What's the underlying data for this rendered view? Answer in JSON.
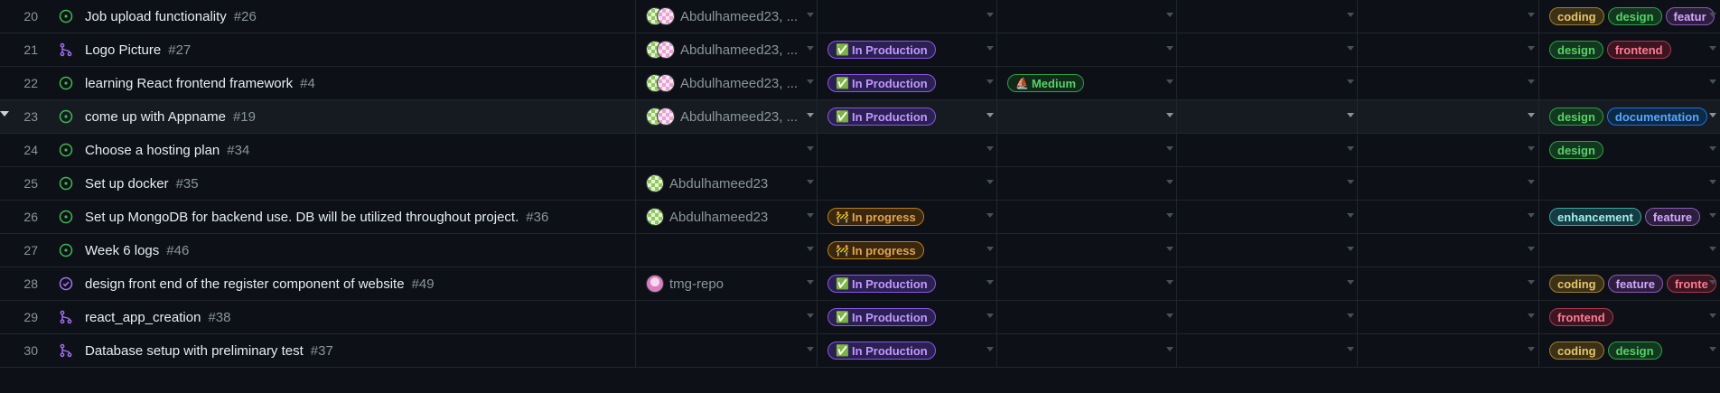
{
  "status_styles": {
    "In Production": {
      "bg": "#2b2052",
      "border": "#8957e5",
      "color": "#c297ff",
      "emoji": "✅"
    },
    "In progress": {
      "bg": "#3a2710",
      "border": "#bb8009",
      "color": "#e3a44d",
      "emoji": "🚧"
    }
  },
  "priority_styles": {
    "Medium": {
      "bg": "#10291a",
      "border": "#2ea043",
      "color": "#56d364",
      "emoji": "⛵"
    }
  },
  "label_styles": {
    "coding": {
      "bg": "#3b3117",
      "border": "#9e7c2f",
      "color": "#e8c56a"
    },
    "design": {
      "bg": "#123820",
      "border": "#2ea043",
      "color": "#56d364"
    },
    "feature": {
      "bg": "#2d1e3d",
      "border": "#8a5ab5",
      "color": "#d2a8ff"
    },
    "frontend": {
      "bg": "#3d1520",
      "border": "#a8394f",
      "color": "#ff7b93"
    },
    "documentation": {
      "bg": "#0d2a45",
      "border": "#1f6feb",
      "color": "#58a6ff"
    },
    "enhancement": {
      "bg": "#153c40",
      "border": "#3aa3a8",
      "color": "#a2eeef"
    }
  },
  "rows": [
    {
      "num": "20",
      "icon": "issue-open",
      "title": "Job upload functionality",
      "ref": "#26",
      "avatars": [
        "green",
        "pink"
      ],
      "assignees": "Abdulhameed23, ...",
      "status": "",
      "priority": "",
      "labels": [
        "coding",
        "design",
        "featur"
      ]
    },
    {
      "num": "21",
      "icon": "pull-request",
      "title": "Logo Picture",
      "ref": "#27",
      "avatars": [
        "green",
        "pink"
      ],
      "assignees": "Abdulhameed23, ...",
      "status": "In Production",
      "priority": "",
      "labels": [
        "design",
        "frontend"
      ]
    },
    {
      "num": "22",
      "icon": "issue-open",
      "title": "learning React frontend framework",
      "ref": "#4",
      "avatars": [
        "green",
        "pink"
      ],
      "assignees": "Abdulhameed23, ...",
      "status": "In Production",
      "priority": "Medium",
      "labels": []
    },
    {
      "num": "23",
      "icon": "issue-open",
      "title": "come up with Appname",
      "ref": "#19",
      "avatars": [
        "green",
        "pink"
      ],
      "assignees": "Abdulhameed23, ...",
      "status": "In Production",
      "priority": "",
      "labels": [
        "design",
        "documentation"
      ],
      "hover": true
    },
    {
      "num": "24",
      "icon": "issue-open",
      "title": "Choose a hosting plan",
      "ref": "#34",
      "avatars": [],
      "assignees": "",
      "status": "",
      "priority": "",
      "labels": [
        "design"
      ]
    },
    {
      "num": "25",
      "icon": "issue-open",
      "title": "Set up docker",
      "ref": "#35",
      "avatars": [
        "green"
      ],
      "assignees": "Abdulhameed23",
      "status": "",
      "priority": "",
      "labels": []
    },
    {
      "num": "26",
      "icon": "issue-open",
      "title": "Set up MongoDB for backend use. DB will be utilized throughout project.",
      "ref": "#36",
      "avatars": [
        "green"
      ],
      "assignees": "Abdulhameed23",
      "status": "In progress",
      "priority": "",
      "labels": [
        "enhancement",
        "feature"
      ]
    },
    {
      "num": "27",
      "icon": "issue-open",
      "title": "Week 6 logs",
      "ref": "#46",
      "avatars": [],
      "assignees": "",
      "status": "In progress",
      "priority": "",
      "labels": []
    },
    {
      "num": "28",
      "icon": "issue-closed",
      "title": "design front end of the register component of website",
      "ref": "#49",
      "avatars": [
        "solo-pink"
      ],
      "assignees": "tmg-repo",
      "status": "In Production",
      "priority": "",
      "labels": [
        "coding",
        "feature",
        "fronte"
      ]
    },
    {
      "num": "29",
      "icon": "pull-request",
      "title": "react_app_creation",
      "ref": "#38",
      "avatars": [],
      "assignees": "",
      "status": "In Production",
      "priority": "",
      "labels": [
        "frontend"
      ]
    },
    {
      "num": "30",
      "icon": "pull-request",
      "title": "Database setup with preliminary test",
      "ref": "#37",
      "avatars": [],
      "assignees": "",
      "status": "In Production",
      "priority": "",
      "labels": [
        "coding",
        "design"
      ]
    }
  ]
}
